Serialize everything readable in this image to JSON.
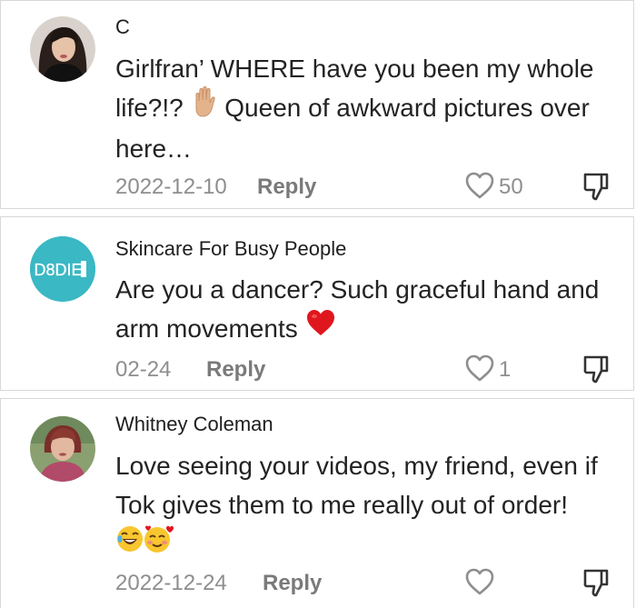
{
  "comments": [
    {
      "username": "C",
      "text": "Girlfran’ WHERE have you been my whole life?!? ",
      "text_after_emoji": " Queen of awkward pictures over here…",
      "emoji": "raised-hand-emoji",
      "date": "2022-12-10",
      "reply_label": "Reply",
      "likes": "50",
      "avatar": "woman-selfie-avatar"
    },
    {
      "username": "Skincare For Busy People",
      "text": "Are you a dancer? Such graceful hand and arm movements ",
      "emoji": "red-heart-emoji",
      "date": "02-24",
      "reply_label": "Reply",
      "likes": "1",
      "avatar_logo_text": "D8DIE",
      "avatar": "teal-logo-avatar"
    },
    {
      "username": "Whitney Coleman",
      "text": "Love seeing your videos, my friend, even if Tok gives them to me really out of order! ",
      "emoji": "laughing-and-smiling-hearts-emoji",
      "date": "2022-12-24",
      "reply_label": "Reply",
      "likes": "",
      "avatar": "woman-portrait-avatar"
    }
  ],
  "colors": {
    "text": "#232323",
    "meta": "#8e8e8e",
    "border": "#d8d8d8",
    "logo_teal": "#3ab8c4",
    "heart_red": "#e0161e"
  }
}
